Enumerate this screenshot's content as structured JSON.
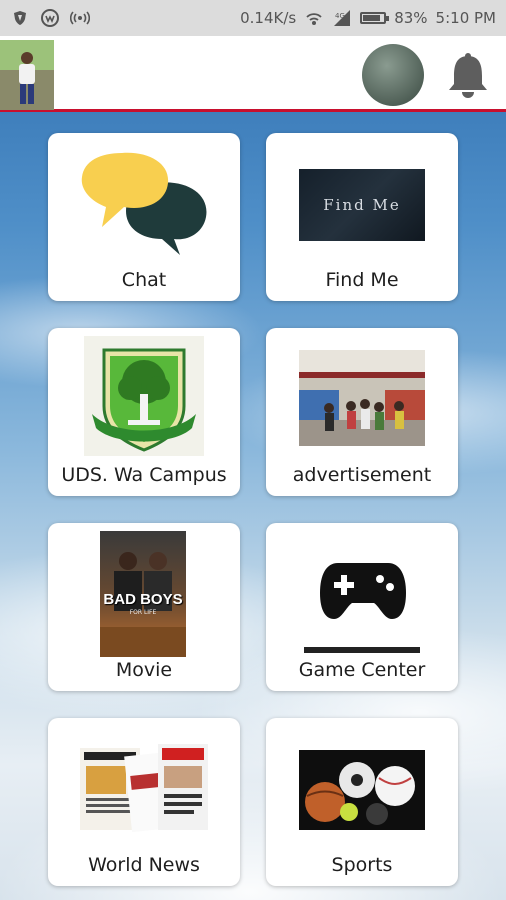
{
  "status_bar": {
    "speed": "0.14K/s",
    "battery_percent": "83%",
    "battery_level": 0.83,
    "time": "5:10 PM"
  },
  "header": {
    "profile_icon": "profile-photo",
    "avatar_icon": "avatar-circle",
    "notification_icon": "bell-icon"
  },
  "tiles": [
    {
      "label": "Chat",
      "icon": "chat-bubbles-icon"
    },
    {
      "label": "Find Me",
      "image_text": "Find Me",
      "icon": "find-me-banner"
    },
    {
      "label": "UDS. Wa Campus",
      "icon": "uds-crest-logo"
    },
    {
      "label": "advertisement",
      "icon": "supermarket-photo"
    },
    {
      "label": "Movie",
      "poster_title": "BAD BOYS",
      "poster_subtitle": "FOR LIFE",
      "icon": "movie-poster"
    },
    {
      "label": "Game Center",
      "icon": "gamepad-icon"
    },
    {
      "label": "World News",
      "icon": "newspapers-photo"
    },
    {
      "label": "Sports",
      "icon": "sports-balls-photo"
    }
  ],
  "colors": {
    "accent_red": "#c8102e",
    "chat_yellow": "#f8cf4f",
    "chat_dark": "#1f3b3b"
  }
}
